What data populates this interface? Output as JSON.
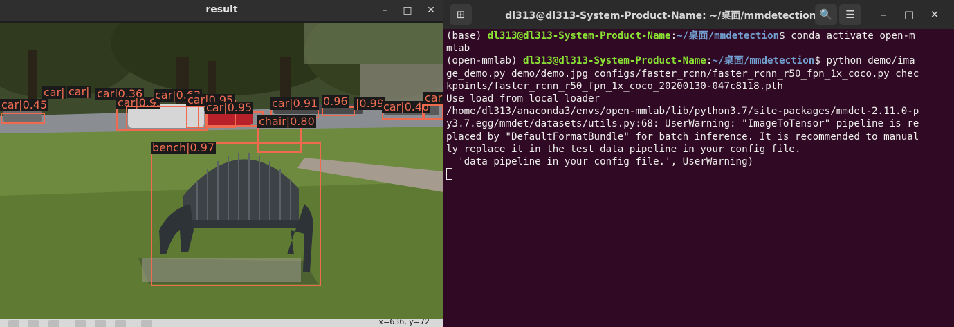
{
  "viewer": {
    "title": "result",
    "minimize_glyph": "–",
    "maximize_glyph": "□",
    "close_glyph": "✕",
    "coords_text": "x=636, y=72",
    "toolbar_icons": [
      "pan-icon",
      "zoom-in-icon",
      "zoom-out-icon",
      "move-icon",
      "zoom-rect-icon",
      "settings-icon",
      "save-icon"
    ],
    "detections": [
      {
        "label": "car|0.45"
      },
      {
        "label": "car|"
      },
      {
        "label": "car|"
      },
      {
        "label": "car|0.36"
      },
      {
        "label": "car|0.95"
      },
      {
        "label": "car|0.63"
      },
      {
        "label": "car|0.95"
      },
      {
        "label": "car|0.95"
      },
      {
        "label": "car|0.91"
      },
      {
        "label": "0.96"
      },
      {
        "label": "|0.99"
      },
      {
        "label": "car|0.46"
      },
      {
        "label": "car"
      },
      {
        "label": "chair|0.80"
      },
      {
        "label": "bench|0.97"
      }
    ]
  },
  "terminal": {
    "title": "dl313@dl313-System-Product-Name: ~/桌面/mmdetection",
    "new_tab_glyph": "⊞",
    "search_glyph": "🔍",
    "menu_glyph": "☰",
    "minimize_glyph": "–",
    "maximize_glyph": "□",
    "close_glyph": "✕",
    "cmd1": {
      "env": "(base) ",
      "user": "dl313@dl313-System-Product-Name",
      "colon": ":",
      "path": "~/桌面/mmdetection",
      "dollar": "$ ",
      "cmd": "conda activate open-m",
      "wrap": "mlab"
    },
    "cmd2": {
      "env": "(open-mmlab) ",
      "user": "dl313@dl313-System-Product-Name",
      "colon": ":",
      "path": "~/桌面/mmdetection",
      "dollar": "$ ",
      "cmd": "python demo/ima",
      "wrap": [
        "ge_demo.py demo/demo.jpg configs/faster_rcnn/faster_rcnn_r50_fpn_1x_coco.py chec",
        "kpoints/faster_rcnn_r50_fpn_1x_coco_20200130-047c8118.pth"
      ]
    },
    "output": [
      "Use load_from_local loader",
      "/home/dl313/anaconda3/envs/open-mmlab/lib/python3.7/site-packages/mmdet-2.11.0-p",
      "y3.7.egg/mmdet/datasets/utils.py:68: UserWarning: \"ImageToTensor\" pipeline is re",
      "placed by \"DefaultFormatBundle\" for batch inference. It is recommended to manual",
      "ly replace it in the test data pipeline in your config file.",
      "  'data pipeline in your config file.', UserWarning)"
    ]
  }
}
